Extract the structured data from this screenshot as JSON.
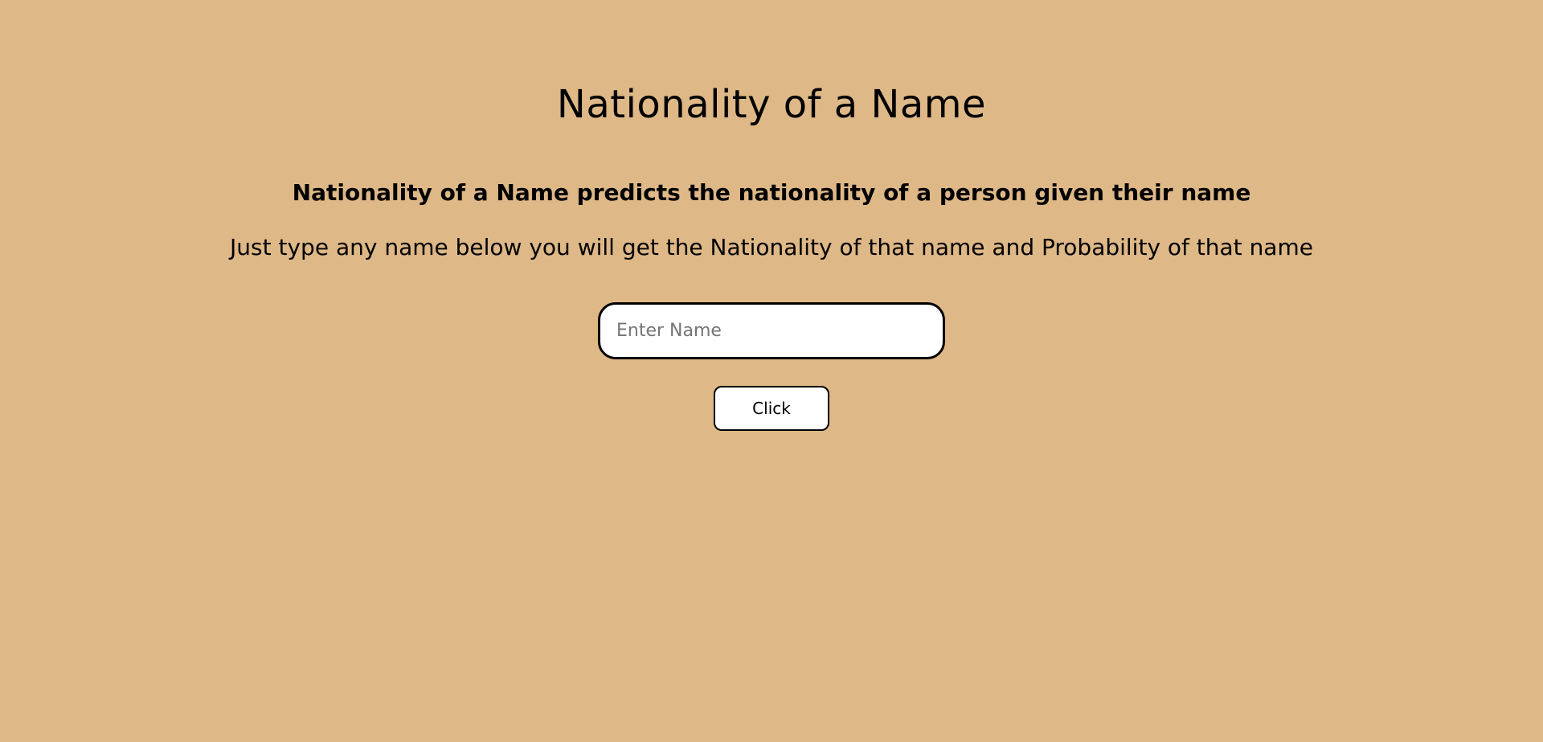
{
  "header": {
    "title": "Nationality of a Name"
  },
  "main": {
    "subtitle": "Nationality of a Name predicts the nationality of a person given their name",
    "instructions": "Just type any name below you will get the Nationality of that name and Probability of that name",
    "name_input": {
      "value": "",
      "placeholder": "Enter Name"
    },
    "submit_label": "Click"
  },
  "colors": {
    "background": "#deb887",
    "text": "#000000",
    "input_background": "#ffffff",
    "border": "#000000"
  }
}
